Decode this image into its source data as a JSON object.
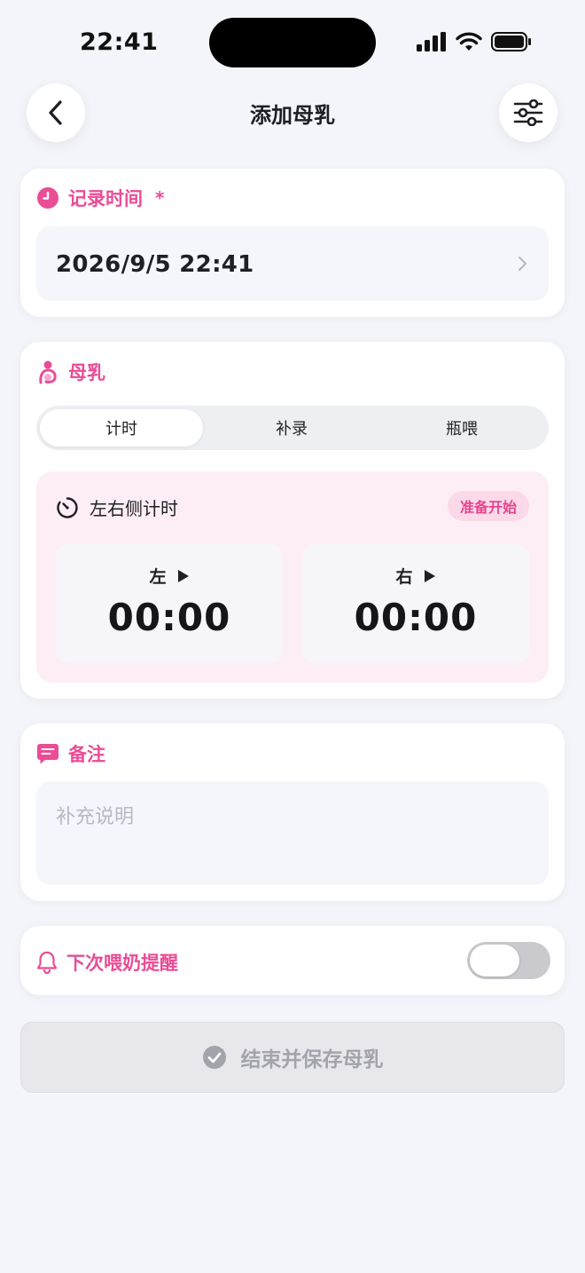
{
  "status_bar": {
    "time": "22:41"
  },
  "nav": {
    "title": "添加母乳"
  },
  "record_time": {
    "title": "记录时间",
    "required_mark": "*",
    "value": "2026/9/5 22:41"
  },
  "breast_milk": {
    "title": "母乳",
    "tabs": [
      "计时",
      "补录",
      "瓶喂"
    ],
    "active_tab_index": 0,
    "timer": {
      "title": "左右侧计时",
      "start_button": "准备开始",
      "left": {
        "label": "左",
        "time": "00:00"
      },
      "right": {
        "label": "右",
        "time": "00:00"
      }
    }
  },
  "notes": {
    "title": "备注",
    "placeholder": "补充说明"
  },
  "reminder": {
    "title": "下次喂奶提醒",
    "enabled": false
  },
  "save_button": {
    "label": "结束并保存母乳"
  },
  "colors": {
    "accent_pink": "#ea4c95",
    "background": "#f4f5fa",
    "disabled_button": "#e8e8ec"
  }
}
